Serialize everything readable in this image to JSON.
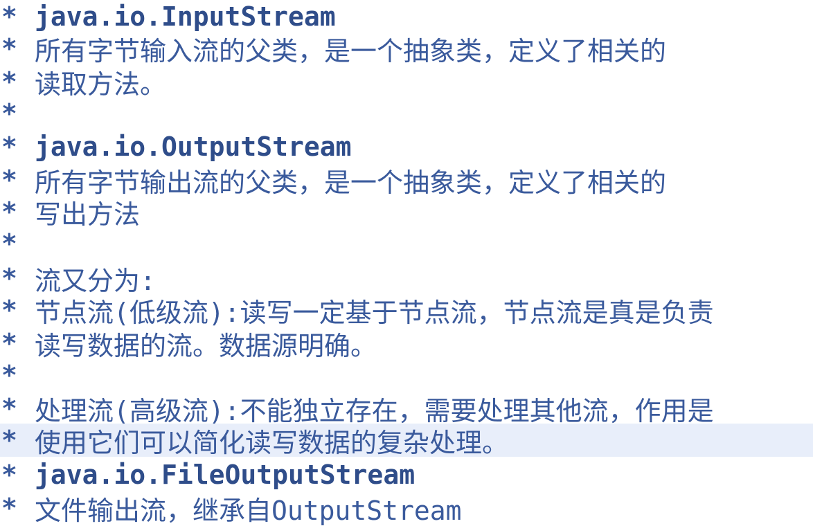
{
  "comment_lines": [
    {
      "marker": "*",
      "text": "java.io.InputStream"
    },
    {
      "marker": "*",
      "text": "所有字节输入流的父类，是一个抽象类，定义了相关的"
    },
    {
      "marker": "*",
      "text": "读取方法。"
    },
    {
      "marker": "*",
      "text": ""
    },
    {
      "marker": "*",
      "text": "java.io.OutputStream"
    },
    {
      "marker": "*",
      "text": "所有字节输出流的父类，是一个抽象类，定义了相关的"
    },
    {
      "marker": "*",
      "text": "写出方法"
    },
    {
      "marker": "*",
      "text": ""
    },
    {
      "marker": "*",
      "text": "流又分为:"
    },
    {
      "marker": "*",
      "text": "节点流(低级流):读写一定基于节点流，节点流是真是负责"
    },
    {
      "marker": "*",
      "text": "读写数据的流。数据源明确。"
    },
    {
      "marker": "*",
      "text": ""
    },
    {
      "marker": "*",
      "text": "处理流(高级流):不能独立存在，需要处理其他流，作用是"
    },
    {
      "marker": "*",
      "text": "使用它们可以简化读写数据的复杂处理。"
    },
    {
      "marker": "*",
      "text": "java.io.FileOutputStream"
    },
    {
      "marker": "*",
      "text": "文件输出流，继承自OutputStream"
    }
  ],
  "colors": {
    "text": "#3a5a9c",
    "current_line_highlight": "#e8eefa",
    "background": "#ffffff"
  }
}
